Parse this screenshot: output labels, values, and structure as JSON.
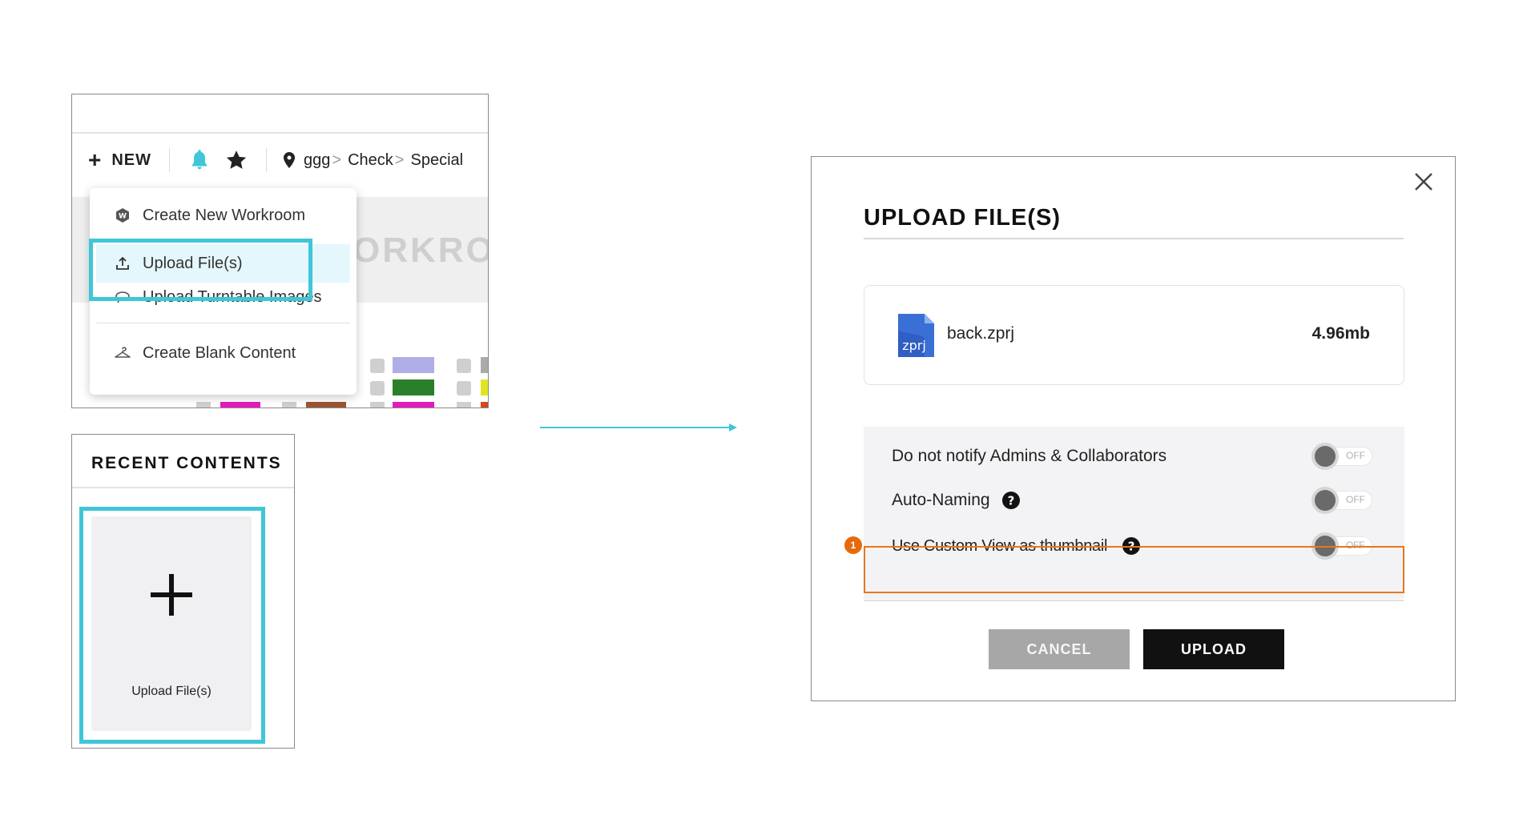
{
  "menu_panel": {
    "new_label": "NEW",
    "breadcrumbs": [
      "ggg",
      "Check",
      "Special"
    ],
    "background_text": "ORKRO",
    "dropdown": {
      "items": [
        {
          "label": "Create New Workroom",
          "icon": "workroom-hexagon-icon"
        },
        {
          "label": "Upload File(s)",
          "icon": "upload-icon"
        },
        {
          "label": "Upload Turntable Images",
          "icon": "turntable-icon"
        },
        {
          "label": "Create Blank Content",
          "icon": "hanger-icon"
        }
      ]
    },
    "bell_color": "#3fc6d8"
  },
  "recent": {
    "title": "RECENT CONTENTS",
    "card_label": "Upload File(s)"
  },
  "dialog": {
    "title": "UPLOAD FILE(S)",
    "file": {
      "name": "back.zprj",
      "size": "4.96mb",
      "icon_text": "zprj"
    },
    "options": [
      {
        "label": "Do not notify Admins & Collaborators",
        "state": "OFF",
        "has_help": false
      },
      {
        "label": "Auto-Naming",
        "state": "OFF",
        "has_help": true
      },
      {
        "label": "Use Custom View as thumbnail",
        "state": "OFF",
        "has_help": true
      }
    ],
    "badge": "1",
    "cancel_label": "CANCEL",
    "upload_label": "UPLOAD"
  },
  "colors": {
    "highlight": "#3fc6d8",
    "orange": "#e7761c",
    "file_icon": "#3a6fd6"
  }
}
